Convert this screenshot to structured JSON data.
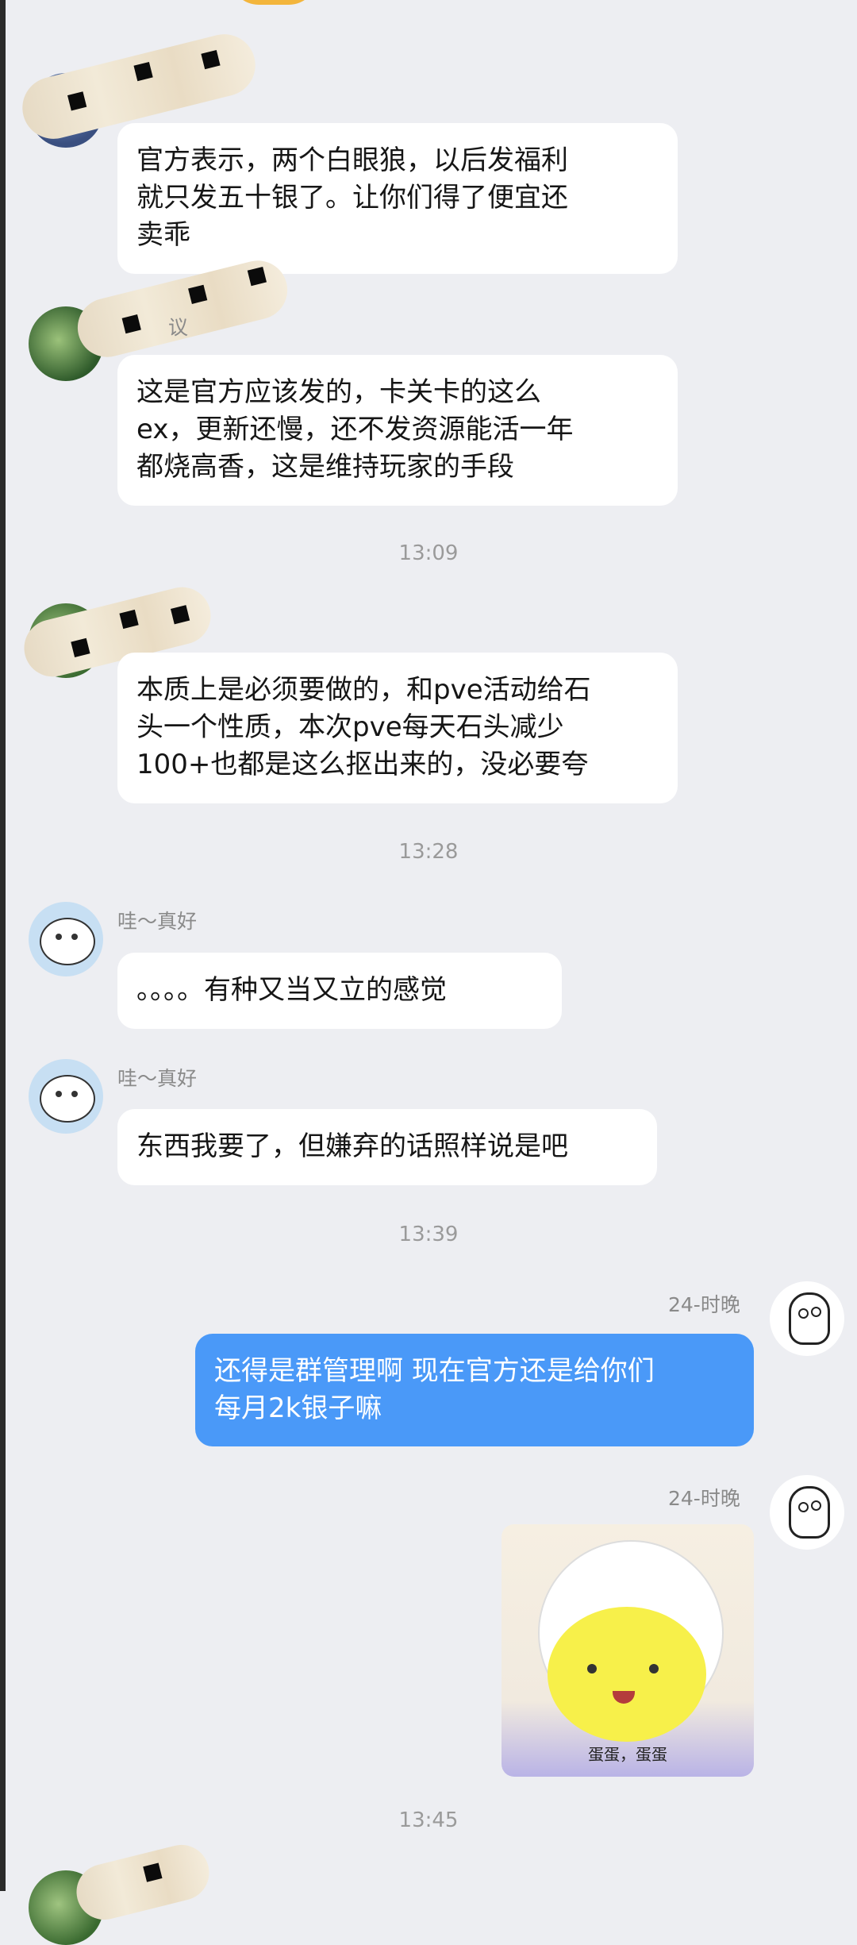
{
  "messages": {
    "m1": "官方表示，两个白眼狼，以后发福利\n就只发五十银了。让你们得了便宜还\n卖乖",
    "m2_sender_fragment": "议",
    "m2": "这是官方应该发的，卡关卡的这么\nex，更新还慢，还不发资源能活一年\n都烧高香，这是维持玩家的手段",
    "m3": "本质上是必须要做的，和pve活动给石\n头一个性质，本次pve每天石头减少\n100+也都是这么抠出来的，没必要夸",
    "m4_sender": "哇～真好",
    "m4": "。。。。有种又当又立的感觉",
    "m5_sender": "哇～真好",
    "m5": "东西我要了，但嫌弃的话照样说是吧",
    "m6_sender": "24-时晚",
    "m6": "还得是群管理啊 现在官方还是给你们\n每月2k银子嘛",
    "m7_sender": "24-时晚",
    "sticker_caption": "蛋蛋，蛋蛋"
  },
  "times": {
    "t1": "13:09",
    "t2": "13:28",
    "t3": "13:39",
    "t4": "13:45"
  },
  "colors": {
    "background": "#edeef2",
    "my_bubble": "#4a99f8",
    "other_bubble": "#ffffff"
  }
}
